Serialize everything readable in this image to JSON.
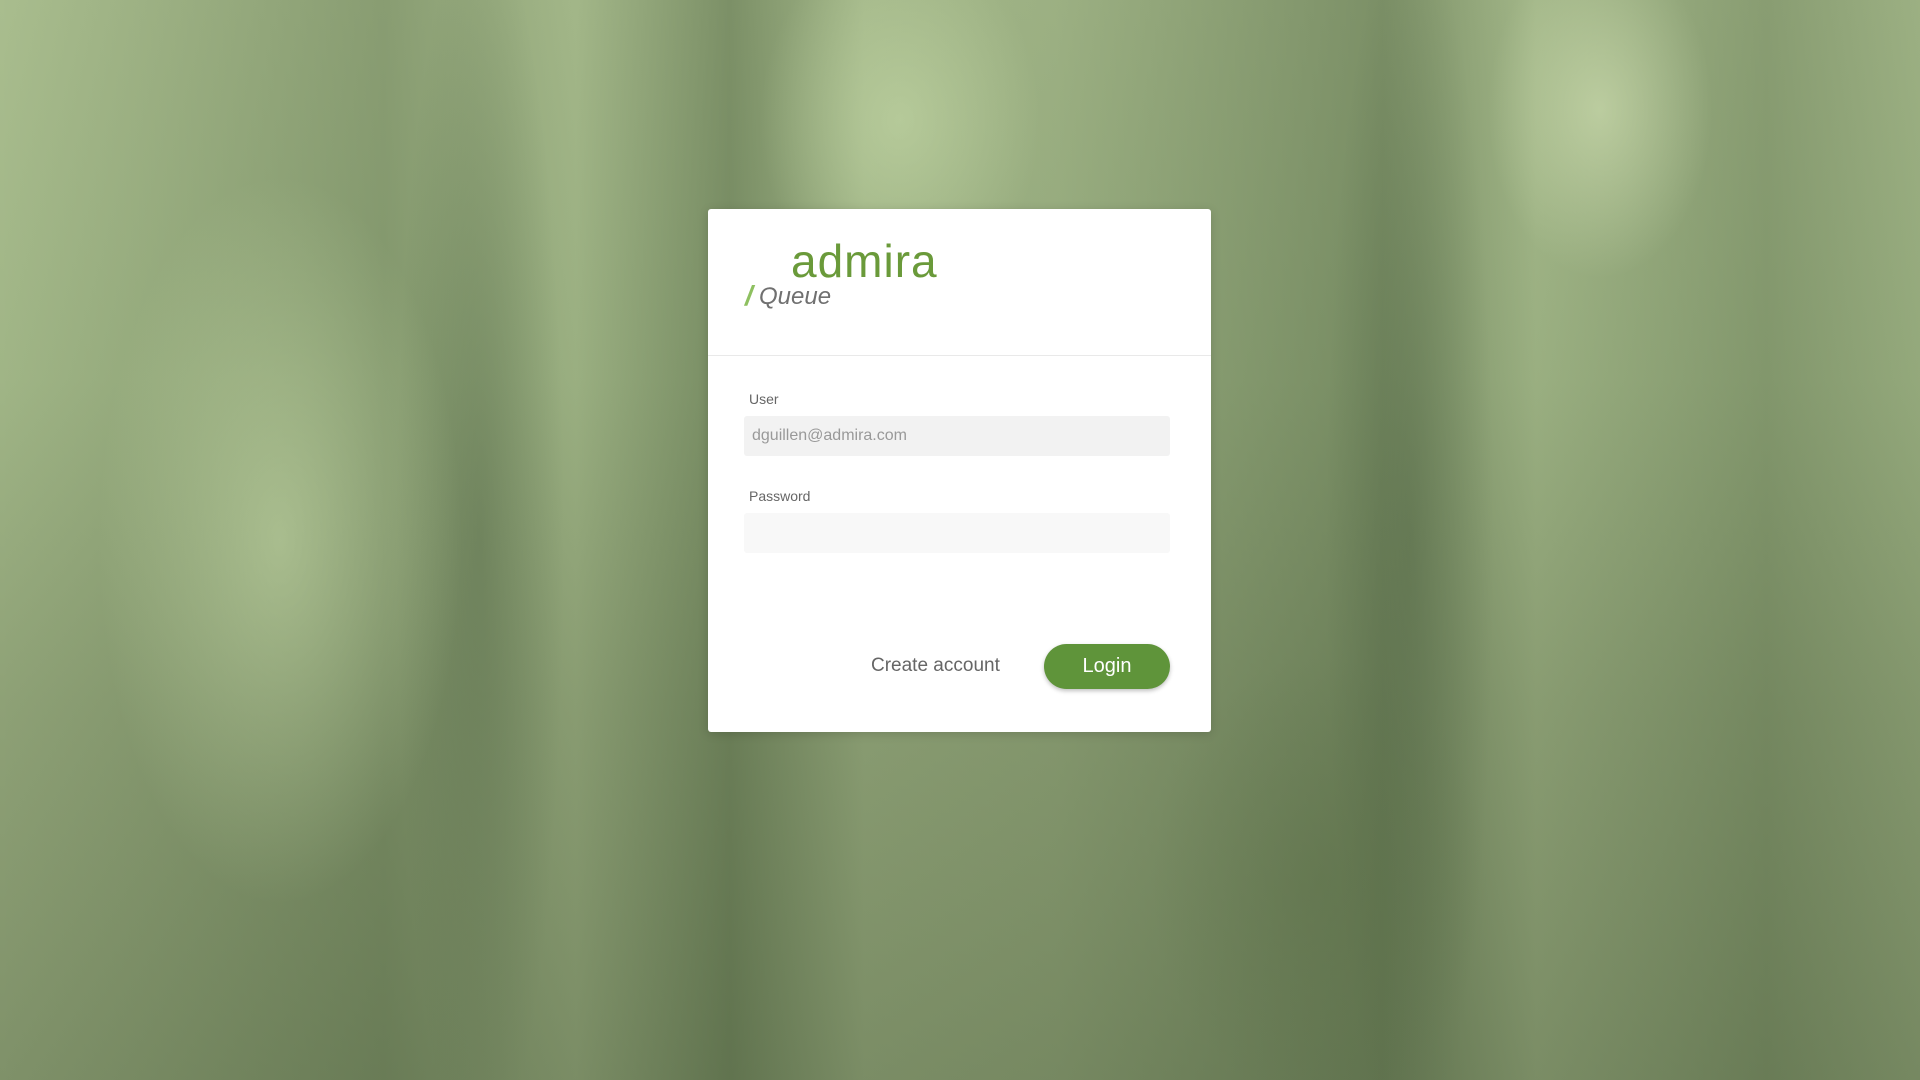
{
  "logo": {
    "brand": "admira",
    "slash": "/",
    "product": "Queue"
  },
  "form": {
    "user_label": "User",
    "user_value": "dguillen@admira.com",
    "password_label": "Password",
    "password_value": ""
  },
  "actions": {
    "create_account_label": "Create account",
    "login_label": "Login"
  },
  "colors": {
    "brand_green": "#6a9a3a",
    "button_green": "#5f943a"
  }
}
